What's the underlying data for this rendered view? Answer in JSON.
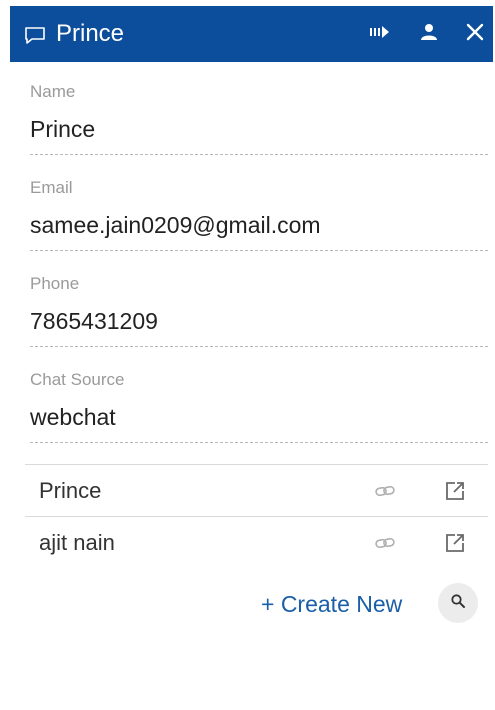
{
  "header": {
    "title": "Prince",
    "background_color": "#0c4d9c",
    "icons": [
      "chat-bubble-icon",
      "transfer-icon",
      "user-icon",
      "close-icon"
    ]
  },
  "fields": {
    "name": {
      "label": "Name",
      "value": "Prince"
    },
    "email": {
      "label": "Email",
      "value": "samee.jain0209@gmail.com"
    },
    "phone": {
      "label": "Phone",
      "value": "7865431209"
    },
    "chat_source": {
      "label": "Chat Source",
      "value": "webchat"
    }
  },
  "contacts": [
    {
      "name": "Prince",
      "icons": [
        "link-icon",
        "open-external-icon"
      ]
    },
    {
      "name": "ajit nain",
      "icons": [
        "link-icon",
        "open-external-icon"
      ]
    }
  ],
  "actions": {
    "create_new_label": "+ Create New",
    "accent_color": "#1a5fa8",
    "search_icon": "search-icon"
  }
}
